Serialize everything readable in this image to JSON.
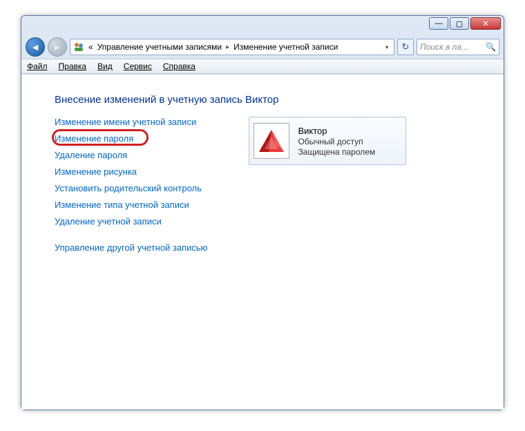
{
  "window": {
    "minimize_glyph": "—",
    "maximize_glyph": "▢",
    "close_glyph": "✕"
  },
  "nav": {
    "back_glyph": "◄",
    "forward_glyph": "►",
    "refresh_glyph": "↻",
    "chevrons": "«",
    "address_seg1": "Управление учетными записями",
    "address_seg2": "Изменение учетной записи",
    "sep_glyph": "▸",
    "dropdown_glyph": "▾",
    "search_placeholder": "Поиск в па...",
    "search_glyph": "🔍"
  },
  "menu": {
    "file": "Файл",
    "edit": "Правка",
    "view": "Вид",
    "tools": "Сервис",
    "help": "Справка"
  },
  "page": {
    "heading": "Внесение изменений в учетную запись Виктор",
    "links": [
      "Изменение имени учетной записи",
      "Изменение пароля",
      "Удаление пароля",
      "Изменение рисунка",
      "Установить родительский контроль",
      "Изменение типа учетной записи",
      "Удаление учетной записи"
    ],
    "other_link": "Управление другой учетной записью"
  },
  "user": {
    "name": "Виктор",
    "role": "Обычный доступ",
    "protection": "Защищена паролем"
  }
}
